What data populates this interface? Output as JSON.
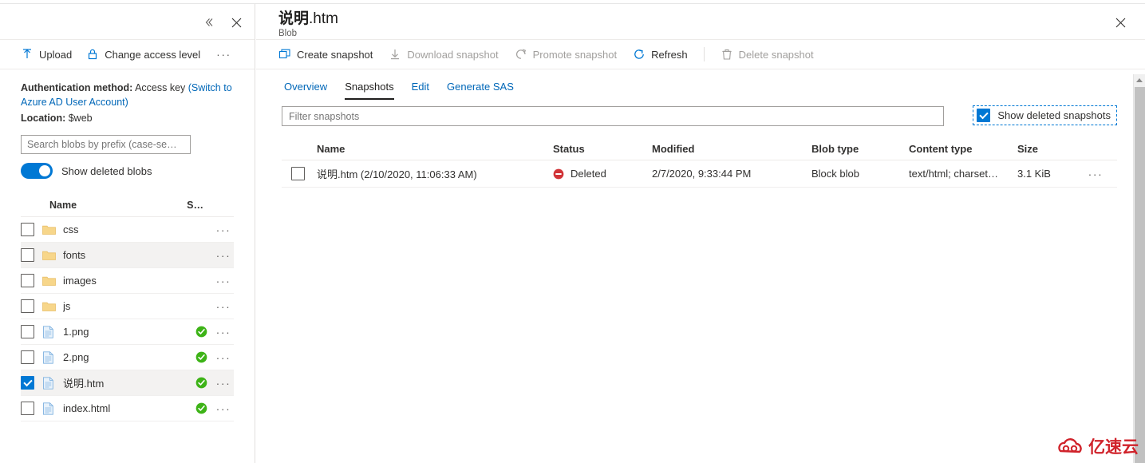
{
  "left_blade": {
    "header_buttons": [
      {
        "name": "collapse",
        "glyph": "«"
      },
      {
        "name": "close",
        "glyph": "✕"
      }
    ],
    "toolbar": {
      "upload_label": "Upload",
      "change_access_label": "Change access level",
      "more_label": "···"
    },
    "auth": {
      "label": "Authentication method:",
      "value": "Access key",
      "switch_link": "(Switch to Azure AD User Account)"
    },
    "location": {
      "label": "Location:",
      "value": "$web"
    },
    "search": {
      "placeholder": "Search blobs by prefix (case-se…",
      "value": ""
    },
    "show_deleted_blobs": {
      "label": "Show deleted blobs",
      "checked": true
    },
    "columns": {
      "name": "Name",
      "size": "S…"
    },
    "rows": [
      {
        "name": "css",
        "type": "folder",
        "checked": false,
        "status": "",
        "alt": false
      },
      {
        "name": "fonts",
        "type": "folder",
        "checked": false,
        "status": "",
        "alt": true
      },
      {
        "name": "images",
        "type": "folder",
        "checked": false,
        "status": "",
        "alt": false
      },
      {
        "name": "js",
        "type": "folder",
        "checked": false,
        "status": "",
        "alt": false
      },
      {
        "name": "1.png",
        "type": "file",
        "checked": false,
        "status": "ok",
        "alt": false
      },
      {
        "name": "2.png",
        "type": "file",
        "checked": false,
        "status": "ok",
        "alt": false
      },
      {
        "name": "说明.htm",
        "type": "file",
        "checked": true,
        "status": "ok",
        "alt": true
      },
      {
        "name": "index.html",
        "type": "file",
        "checked": false,
        "status": "ok",
        "alt": false
      }
    ]
  },
  "right_blade": {
    "title_main": "说明",
    "title_ext": ".htm",
    "subtitle": "Blob",
    "close_glyph": "✕",
    "toolbar": [
      {
        "label": "Create snapshot",
        "icon": "copy-icon",
        "disabled": false
      },
      {
        "label": "Download snapshot",
        "icon": "download-icon",
        "disabled": true
      },
      {
        "label": "Promote snapshot",
        "icon": "promote-icon",
        "disabled": true
      },
      {
        "label": "Refresh",
        "icon": "refresh-icon",
        "disabled": false
      },
      {
        "label": "Delete snapshot",
        "icon": "trash-icon",
        "disabled": true
      }
    ],
    "tabs": [
      {
        "label": "Overview",
        "active": false
      },
      {
        "label": "Snapshots",
        "active": true
      },
      {
        "label": "Edit",
        "active": false
      },
      {
        "label": "Generate SAS",
        "active": false
      }
    ],
    "filter": {
      "placeholder": "Filter snapshots",
      "value": ""
    },
    "show_deleted_snapshots": {
      "label": "Show deleted snapshots",
      "checked": true
    },
    "grid": {
      "columns": [
        "Name",
        "Status",
        "Modified",
        "Blob type",
        "Content type",
        "Size"
      ],
      "rows": [
        {
          "checked": false,
          "name": "说明.htm (2/10/2020, 11:06:33 AM)",
          "status": "Deleted",
          "modified": "2/7/2020, 9:33:44 PM",
          "blob_type": "Block blob",
          "content_type": "text/html; charset…",
          "size": "3.1 KiB",
          "more": "···"
        }
      ]
    }
  },
  "watermark": {
    "text": "亿速云"
  },
  "colors": {
    "accent": "#0078d4",
    "link": "#0067b8",
    "deleted": "#d13438",
    "ok": "#3db317",
    "folder": "#f6d488",
    "watermark": "#d0232b"
  }
}
